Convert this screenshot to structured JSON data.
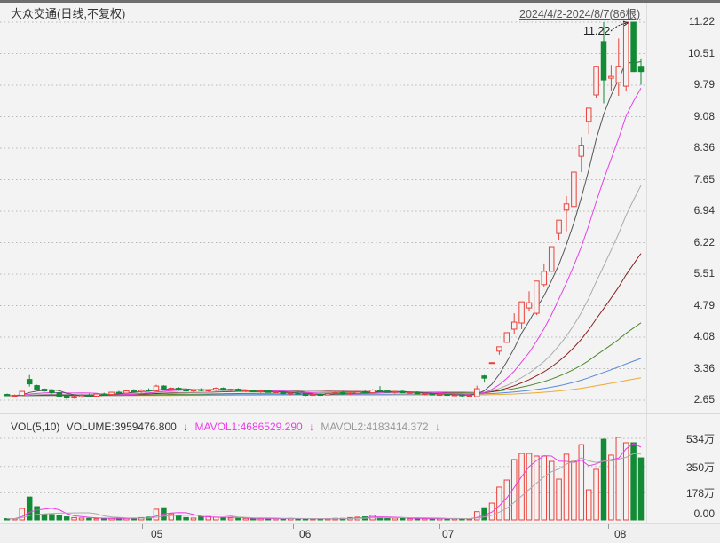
{
  "header": {
    "title": "大众交通(日线,不复权)",
    "range": "2024/4/2-2024/8/7(86根)",
    "high_label": "11.22"
  },
  "price_axis": [
    "11.22",
    "10.51",
    "9.79",
    "9.08",
    "8.36",
    "7.65",
    "6.94",
    "6.22",
    "5.51",
    "4.79",
    "4.08",
    "3.36",
    "2.65"
  ],
  "volume_axis": [
    "534万",
    "350万",
    "178万",
    "0.00"
  ],
  "volume_header": {
    "name": "VOL(5,10)",
    "volume": "VOLUME:3959476.800",
    "arrow1": "↓",
    "mavol1": "MAVOL1:4686529.290",
    "arrow2": "↓",
    "mavol2": "MAVOL2:4183414.372",
    "arrow3": "↓"
  },
  "months": [
    "05",
    "06",
    "07",
    "08"
  ],
  "colors": {
    "up": "#e8413a",
    "down": "#138a36",
    "ma5": "#555555",
    "ma10": "#e83ee8",
    "ma20": "#aaaaaa",
    "ma30": "#8b2020",
    "ma60": "#4e8a2e",
    "ma120": "#5a8ad8",
    "ma250": "#f0a830"
  },
  "chart_data": {
    "type": "candlestick",
    "price_range": [
      2.65,
      11.22
    ],
    "volume_range_wan": [
      0,
      534
    ],
    "ma_windows": [
      5,
      10,
      20,
      30,
      60,
      120,
      250
    ],
    "ohlc": [
      [
        2.78,
        2.8,
        2.74,
        2.75
      ],
      [
        2.75,
        2.78,
        2.72,
        2.76
      ],
      [
        2.76,
        2.86,
        2.75,
        2.85
      ],
      [
        3.12,
        3.22,
        2.96,
        3.02
      ],
      [
        2.98,
        3.0,
        2.88,
        2.9
      ],
      [
        2.9,
        2.92,
        2.84,
        2.86
      ],
      [
        2.86,
        2.88,
        2.8,
        2.82
      ],
      [
        2.82,
        2.84,
        2.72,
        2.74
      ],
      [
        2.74,
        2.76,
        2.65,
        2.7
      ],
      [
        2.7,
        2.76,
        2.68,
        2.73
      ],
      [
        2.73,
        2.78,
        2.7,
        2.76
      ],
      [
        2.76,
        2.8,
        2.72,
        2.74
      ],
      [
        2.74,
        2.8,
        2.73,
        2.79
      ],
      [
        2.79,
        2.82,
        2.76,
        2.78
      ],
      [
        2.78,
        2.84,
        2.77,
        2.83
      ],
      [
        2.83,
        2.86,
        2.79,
        2.81
      ],
      [
        2.81,
        2.88,
        2.8,
        2.86
      ],
      [
        2.86,
        2.9,
        2.83,
        2.85
      ],
      [
        2.85,
        2.9,
        2.82,
        2.88
      ],
      [
        2.88,
        2.92,
        2.84,
        2.86
      ],
      [
        2.86,
        3.0,
        2.85,
        2.97
      ],
      [
        2.97,
        2.99,
        2.88,
        2.9
      ],
      [
        2.9,
        2.94,
        2.86,
        2.92
      ],
      [
        2.92,
        2.95,
        2.86,
        2.88
      ],
      [
        2.88,
        2.92,
        2.84,
        2.86
      ],
      [
        2.86,
        2.9,
        2.83,
        2.89
      ],
      [
        2.89,
        2.92,
        2.85,
        2.87
      ],
      [
        2.87,
        2.9,
        2.84,
        2.88
      ],
      [
        2.88,
        2.94,
        2.86,
        2.92
      ],
      [
        2.92,
        2.94,
        2.87,
        2.88
      ],
      [
        2.88,
        2.91,
        2.85,
        2.9
      ],
      [
        2.9,
        2.92,
        2.85,
        2.86
      ],
      [
        2.86,
        2.89,
        2.83,
        2.87
      ],
      [
        2.87,
        2.89,
        2.83,
        2.84
      ],
      [
        2.84,
        2.88,
        2.82,
        2.86
      ],
      [
        2.86,
        2.88,
        2.82,
        2.83
      ],
      [
        2.83,
        2.86,
        2.8,
        2.84
      ],
      [
        2.84,
        2.86,
        2.78,
        2.8
      ],
      [
        2.8,
        2.83,
        2.76,
        2.81
      ],
      [
        2.81,
        2.84,
        2.78,
        2.79
      ],
      [
        2.79,
        2.82,
        2.74,
        2.76
      ],
      [
        2.76,
        2.8,
        2.74,
        2.78
      ],
      [
        2.78,
        2.81,
        2.75,
        2.77
      ],
      [
        2.77,
        2.82,
        2.76,
        2.8
      ],
      [
        2.8,
        2.84,
        2.78,
        2.82
      ],
      [
        2.82,
        2.85,
        2.77,
        2.79
      ],
      [
        2.79,
        2.83,
        2.77,
        2.81
      ],
      [
        2.81,
        2.86,
        2.8,
        2.84
      ],
      [
        2.84,
        2.88,
        2.8,
        2.82
      ],
      [
        2.82,
        2.9,
        2.81,
        2.88
      ],
      [
        2.88,
        2.97,
        2.84,
        2.86
      ],
      [
        2.86,
        2.89,
        2.82,
        2.83
      ],
      [
        2.83,
        2.86,
        2.8,
        2.85
      ],
      [
        2.85,
        2.88,
        2.81,
        2.82
      ],
      [
        2.82,
        2.85,
        2.79,
        2.83
      ],
      [
        2.83,
        2.85,
        2.78,
        2.79
      ],
      [
        2.79,
        2.82,
        2.76,
        2.8
      ],
      [
        2.8,
        2.82,
        2.76,
        2.77
      ],
      [
        2.77,
        2.8,
        2.75,
        2.78
      ],
      [
        2.78,
        2.8,
        2.74,
        2.76
      ],
      [
        2.76,
        2.79,
        2.74,
        2.77
      ],
      [
        2.77,
        2.78,
        2.73,
        2.75
      ],
      [
        2.75,
        2.78,
        2.72,
        2.76
      ],
      [
        2.73,
        2.98,
        2.72,
        2.91
      ],
      [
        3.2,
        3.22,
        3.05,
        3.15
      ],
      [
        3.5,
        3.51,
        3.49,
        3.5
      ],
      [
        3.76,
        3.86,
        3.68,
        3.86
      ],
      [
        3.96,
        4.18,
        3.96,
        4.18
      ],
      [
        4.26,
        4.62,
        4.14,
        4.42
      ],
      [
        4.4,
        4.88,
        4.26,
        4.88
      ],
      [
        4.74,
        5.12,
        4.66,
        4.86
      ],
      [
        4.62,
        5.35,
        4.58,
        5.35
      ],
      [
        5.27,
        5.75,
        5.22,
        5.57
      ],
      [
        5.57,
        6.13,
        5.57,
        6.13
      ],
      [
        6.43,
        6.73,
        6.27,
        6.73
      ],
      [
        6.96,
        7.28,
        6.48,
        7.1
      ],
      [
        7.04,
        7.82,
        7.04,
        7.82
      ],
      [
        8.18,
        8.62,
        7.82,
        8.43
      ],
      [
        8.97,
        9.27,
        8.68,
        9.27
      ],
      [
        9.57,
        10.22,
        9.5,
        10.22
      ],
      [
        10.78,
        11.22,
        9.38,
        9.91
      ],
      [
        9.95,
        10.25,
        9.65,
        9.99
      ],
      [
        9.85,
        10.85,
        9.55,
        10.22
      ],
      [
        9.77,
        11.22,
        9.65,
        11.22
      ],
      [
        11.22,
        11.22,
        10.1,
        10.1
      ],
      [
        10.22,
        10.4,
        9.8,
        10.1
      ]
    ],
    "volume_wan": [
      8,
      8,
      75,
      150,
      87,
      35,
      35,
      28,
      20,
      15,
      12,
      10,
      8,
      10,
      10,
      12,
      10,
      12,
      15,
      18,
      70,
      80,
      40,
      30,
      15,
      12,
      20,
      22,
      18,
      15,
      12,
      10,
      10,
      8,
      8,
      10,
      8,
      8,
      10,
      8,
      8,
      6,
      6,
      8,
      10,
      10,
      15,
      18,
      20,
      30,
      15,
      10,
      12,
      10,
      8,
      8,
      8,
      8,
      10,
      8,
      8,
      6,
      6,
      54,
      80,
      110,
      215,
      261,
      395,
      435,
      435,
      418,
      418,
      383,
      267,
      430,
      383,
      493,
      197,
      331,
      528,
      424,
      540,
      505,
      505,
      406
    ]
  }
}
